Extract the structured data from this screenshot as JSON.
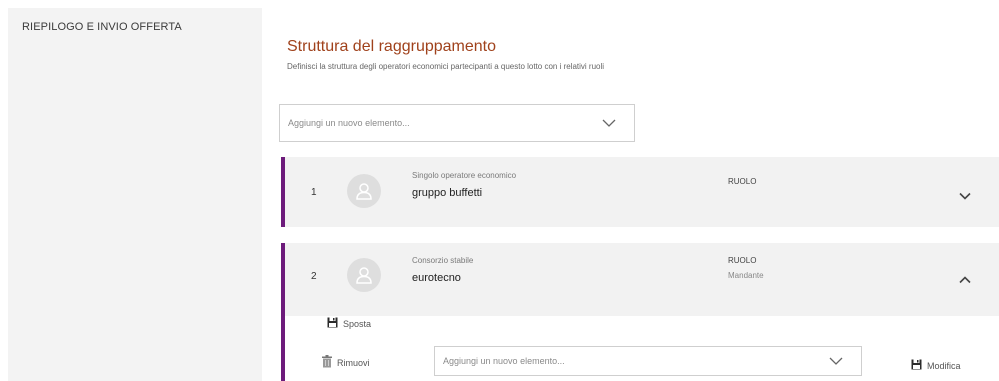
{
  "sidebar": {
    "items": [
      {
        "label": "RIEPILOGO E INVIO OFFERTA"
      }
    ]
  },
  "main": {
    "title": "Struttura del raggruppamento",
    "subtitle": "Definisci la struttura degli operatori economici partecipanti a questo lotto con i relativi ruoli",
    "add_select": {
      "placeholder": "Aggiungi un nuovo elemento..."
    },
    "members": [
      {
        "index": "1",
        "type": "Singolo operatore economico",
        "name": "gruppo buffetti",
        "role_label": "RUOLO",
        "role_value": "",
        "expanded": false
      },
      {
        "index": "2",
        "type": "Consorzio stabile",
        "name": "eurotecno",
        "role_label": "RUOLO",
        "role_value": "Mandante",
        "expanded": true,
        "actions": {
          "move_label": "Sposta",
          "remove_label": "Rimuovi",
          "edit_label": "Modifica"
        },
        "add_select": {
          "placeholder": "Aggiungi un nuovo elemento..."
        }
      }
    ]
  },
  "colors": {
    "accent_title": "#a0421c",
    "card_border": "#6d1b7b",
    "card_bg": "#f2f2f2",
    "sidebar_bg": "#f3f3f3"
  },
  "icons": {
    "avatar": "user-avatar-icon",
    "chevron_down": "chevron-down-icon",
    "chevron_up": "chevron-up-icon",
    "save": "floppy-disk-icon",
    "trash": "trash-icon"
  }
}
